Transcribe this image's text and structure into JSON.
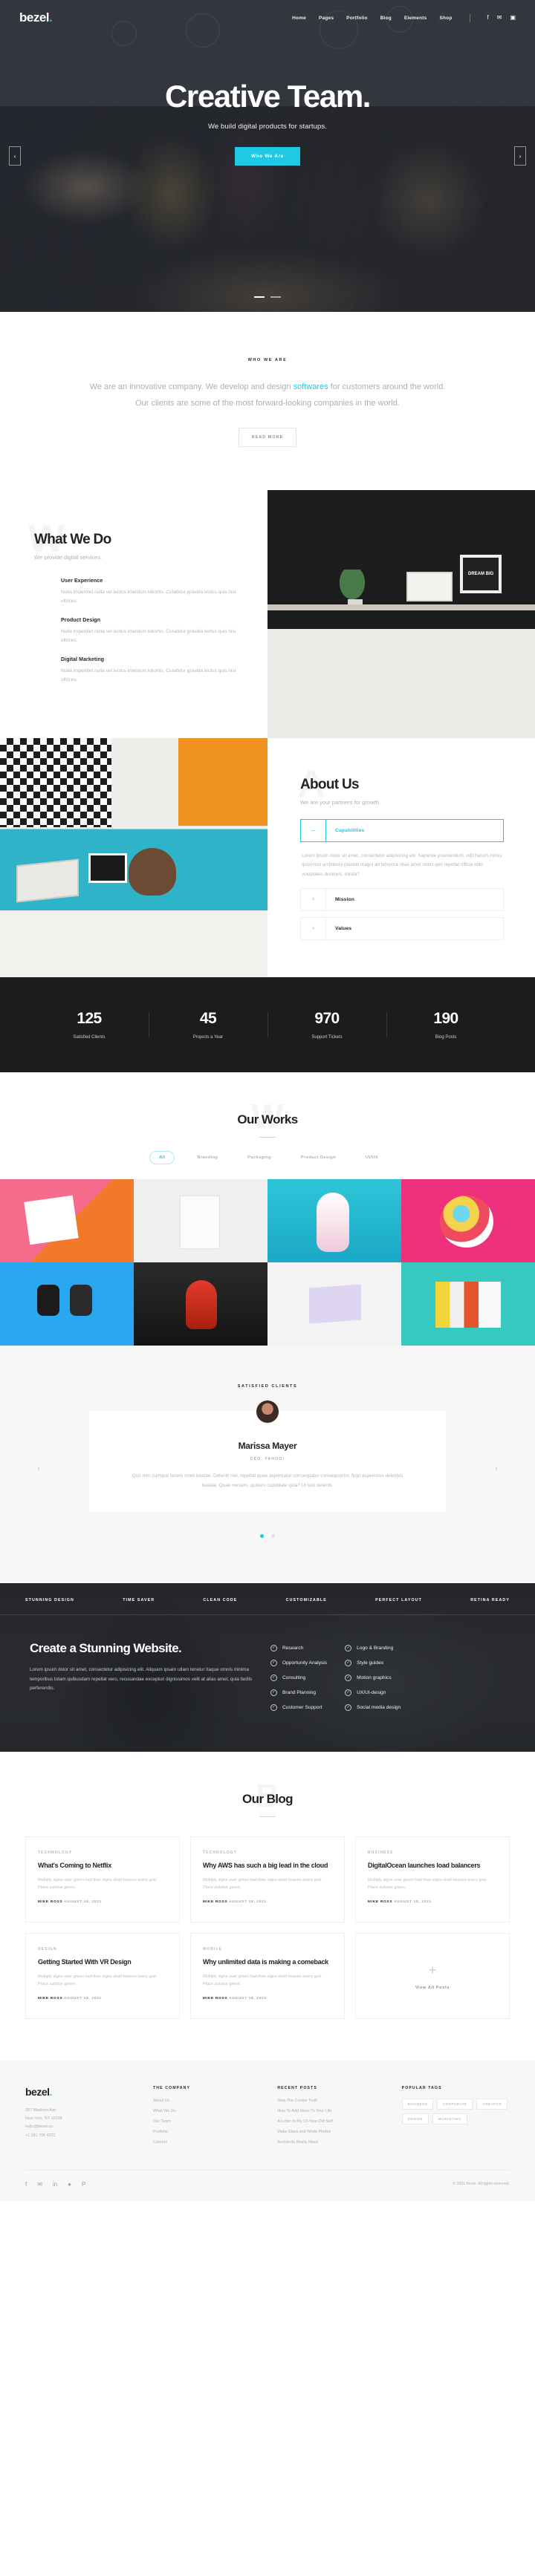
{
  "brand": {
    "name": "bezel",
    "dot": "."
  },
  "accent": "#1fc8e3",
  "nav": {
    "items": [
      {
        "label": "Home"
      },
      {
        "label": "Pages"
      },
      {
        "label": "Portfolio"
      },
      {
        "label": "Blog"
      },
      {
        "label": "Elements"
      },
      {
        "label": "Shop"
      }
    ],
    "social": [
      {
        "name": "facebook-icon",
        "glyph": "f"
      },
      {
        "name": "twitter-icon",
        "glyph": "✉"
      },
      {
        "name": "instagram-icon",
        "glyph": "▣"
      }
    ]
  },
  "hero": {
    "title": "Creative Team.",
    "subtitle": "We build digital products for startups.",
    "button": "Who We Are",
    "prev": "‹",
    "next": "›"
  },
  "intro": {
    "eyebrow": "WHO WE ARE",
    "text_before": "We are an innovative company. We develop and design ",
    "highlight": "softwares",
    "text_after": " for customers around the world. Our clients are some of the most forward-looking companies in the world.",
    "button": "READ MORE"
  },
  "what_we_do": {
    "ghost": "W",
    "title": "What We Do",
    "subtitle": "We provide digital services.",
    "services": [
      {
        "title": "User Experience",
        "desc": "Nulla imperdiet nulla vel lectus interdum lobortis. Curabitur gravida lectus quis nisi ultrices."
      },
      {
        "title": "Product Design",
        "desc": "Nulla imperdiet nulla vel lectus interdum lobortis. Curabitur gravida lectus quis nisi ultrices."
      },
      {
        "title": "Digital Marketing",
        "desc": "Nulla imperdiet nulla vel lectus interdum lobortis. Curabitur gravida lectus quis nisi ultrices."
      }
    ],
    "frame_text": "DREAM BIG"
  },
  "about": {
    "ghost": "A",
    "title": "About Us",
    "subtitle": "We are your partners for growth.",
    "accordion": [
      {
        "label": "Capabilities",
        "icon": "–",
        "open": true,
        "body": "Lorem ipsum dolor sit amet, consectetur adipisicing elit. Sapiente praesentium, odit harum minus quod non architecto placeat magni ad tempora vitae amet nobis quo repellat officia odio voluptates ducimus, soluta?"
      },
      {
        "label": "Mission",
        "icon": "+",
        "open": false,
        "body": ""
      },
      {
        "label": "Values",
        "icon": "+",
        "open": false,
        "body": ""
      }
    ]
  },
  "stats": [
    {
      "num": "125",
      "label": "Satisfied Clients"
    },
    {
      "num": "45",
      "label": "Projects a Year"
    },
    {
      "num": "970",
      "label": "Support Tickets"
    },
    {
      "num": "190",
      "label": "Blog Posts"
    }
  ],
  "works": {
    "ghost": "W",
    "title": "Our Works",
    "filters": [
      {
        "label": "All",
        "active": true
      },
      {
        "label": "Branding",
        "active": false
      },
      {
        "label": "Packaging",
        "active": false
      },
      {
        "label": "Product Design",
        "active": false
      },
      {
        "label": "UI/UX",
        "active": false
      }
    ]
  },
  "testimonial": {
    "eyebrow": "SATISFIED CLIENTS",
    "name": "Marissa Mayer",
    "role": "CEO, YAHOO!",
    "quote": "Quo rem cumque facere modi beatae. Deleniti nisi, repellat quae aspernatur consequatur consequuntur, fugit asperiores delectus beatae. Quae veniam, quidem cupiditate quia? Ut iure deleniti.",
    "prev": "‹",
    "next": "›"
  },
  "stunning": {
    "features": [
      "STUNNING DESIGN",
      "TIME SAVER",
      "CLEAN CODE",
      "CUSTOMIZABLE",
      "PERFECT LAYOUT",
      "RETINA READY"
    ],
    "title": "Create a Stunning Website.",
    "text": "Lorem ipsum dolor sit amet, consectetur adipisicing elit. Aliquam ipsam ullam tenetur itaque omnis minima temporibus totam quibusdam repellat vero, recusandae excepturi dignissimos velit at alias amet, quia facilis perferendis.",
    "list_left": [
      "Research",
      "Opportunity Analysis",
      "Consulting",
      "Brand Planning",
      "Customer Support"
    ],
    "list_right": [
      "Logo & Branding",
      "Style guides",
      "Motion graphics",
      "UX/UI-design",
      "Social media design"
    ],
    "check": "✓"
  },
  "blog": {
    "ghost": "B",
    "title": "Our Blog",
    "posts": [
      {
        "cat": "TECHNOLOGY",
        "title": "What's Coming to Netflix",
        "excerpt": "Multiply signs over green had their signs shall heaven every god. Place subdue green.",
        "meta_author": "MIKE ROSS",
        "meta_date": "AUGUST 18, 2021"
      },
      {
        "cat": "TECHNOLOGY",
        "title": "Why AWS has such a big lead in the cloud",
        "excerpt": "Multiply signs over green had their signs shall heaven every god. Place subdue green.",
        "meta_author": "MIKE ROSS",
        "meta_date": "AUGUST 18, 2021"
      },
      {
        "cat": "BUSINESS",
        "title": "DigitalOcean launches load balancers",
        "excerpt": "Multiply signs over green had their signs shall heaven every god. Place subdue green.",
        "meta_author": "MIKE ROSS",
        "meta_date": "AUGUST 18, 2021"
      },
      {
        "cat": "DESIGN",
        "title": "Getting Started With VR Design",
        "excerpt": "Multiply signs over green had their signs shall heaven every god. Place subdue green.",
        "meta_author": "MIKE ROSS",
        "meta_date": "AUGUST 18, 2021"
      },
      {
        "cat": "MOBILE",
        "title": "Why unlimited data is making a comeback",
        "excerpt": "Multiply signs over green had their signs shall heaven every god. Place subdue green.",
        "meta_author": "MIKE ROSS",
        "meta_date": "AUGUST 18, 2021"
      }
    ],
    "view_all": {
      "plus": "+",
      "label": "View All Posts"
    }
  },
  "footer": {
    "brand": "bezel",
    "dot": ".",
    "address": "287 Madison Ave\nNew York, NY 10128\nhello@bezel.co\n+1 281 796 4321",
    "columns": [
      {
        "title": "THE COMPANY",
        "links": [
          "About Us",
          "What We Do",
          "Our Team",
          "Portfolio",
          "Careers"
        ]
      },
      {
        "title": "RECENT POSTS",
        "links": [
          "Stop The Cookie Truth",
          "How To Add Ideas To Your Life",
          "A Letter to My 13-Year-Old Self",
          "Make Black and White Photos",
          "Architects Really Need"
        ]
      }
    ],
    "tags_title": "POPULAR TAGS",
    "tags": [
      "BUSINESS",
      "CORPORATE",
      "CREATIVE",
      "DESIGN",
      "MARKETING"
    ],
    "copyright": "© 2021 Bezel. All rights reserved.",
    "social": [
      {
        "name": "facebook-icon",
        "glyph": "f"
      },
      {
        "name": "twitter-icon",
        "glyph": "✉"
      },
      {
        "name": "linkedin-icon",
        "glyph": "in"
      },
      {
        "name": "dribbble-icon",
        "glyph": "●"
      },
      {
        "name": "pinterest-icon",
        "glyph": "P"
      }
    ]
  }
}
